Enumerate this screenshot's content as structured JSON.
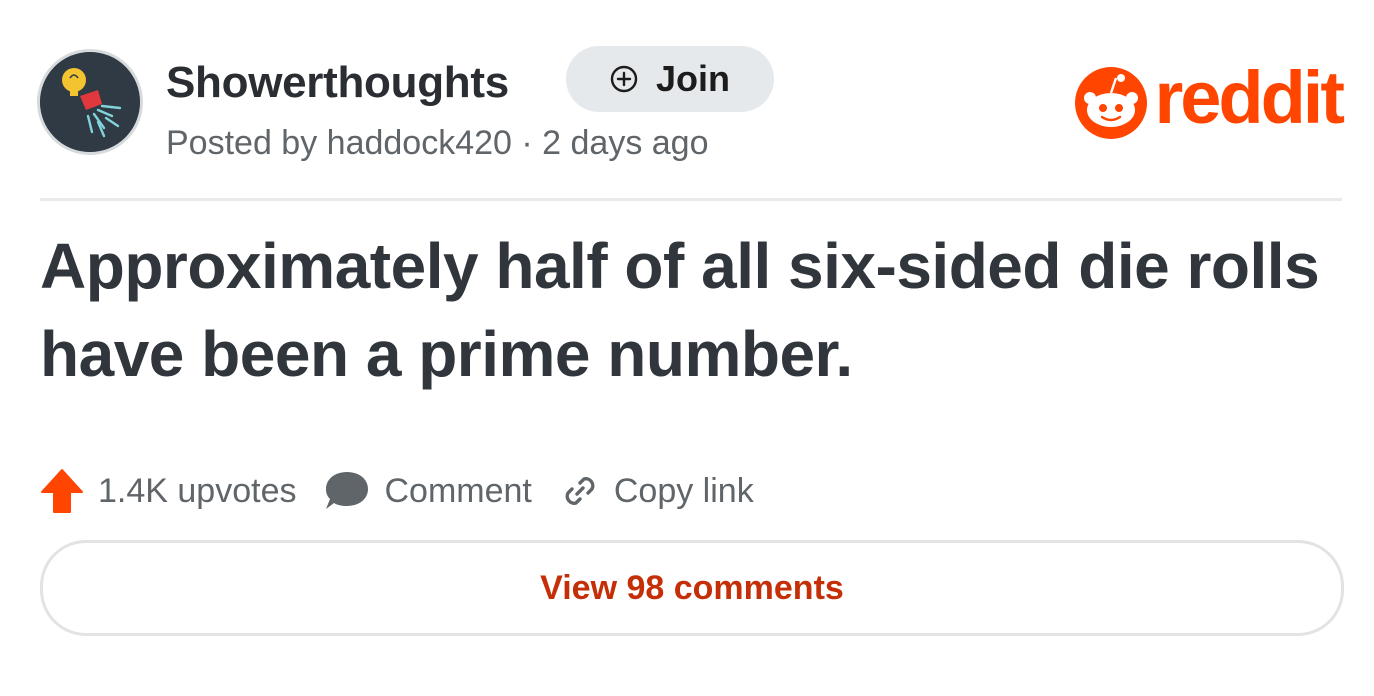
{
  "post": {
    "subreddit": "Showerthoughts",
    "posted_by": "Posted by haddock420 · 2 days ago",
    "title": "Approximately half of all six-sided die rolls have been a prime number."
  },
  "join": {
    "label": "Join"
  },
  "brand": {
    "wordmark": "reddit",
    "color": "#ff4500"
  },
  "actions": {
    "upvotes": "1.4K upvotes",
    "comment": "Comment",
    "copy_link": "Copy link"
  },
  "footer": {
    "view_comments": "View 98 comments"
  },
  "icons": {
    "avatar": "showerhead-lightbulb-icon",
    "join": "plus-circle-icon",
    "logo": "snoo-icon",
    "upvote": "arrow-up-icon",
    "comment": "speech-bubble-icon",
    "link": "chain-link-icon"
  },
  "colors": {
    "accent": "#ff4500",
    "view_comments_text": "#c42f07",
    "title_text": "#31363c",
    "meta_text": "#5f6569"
  }
}
